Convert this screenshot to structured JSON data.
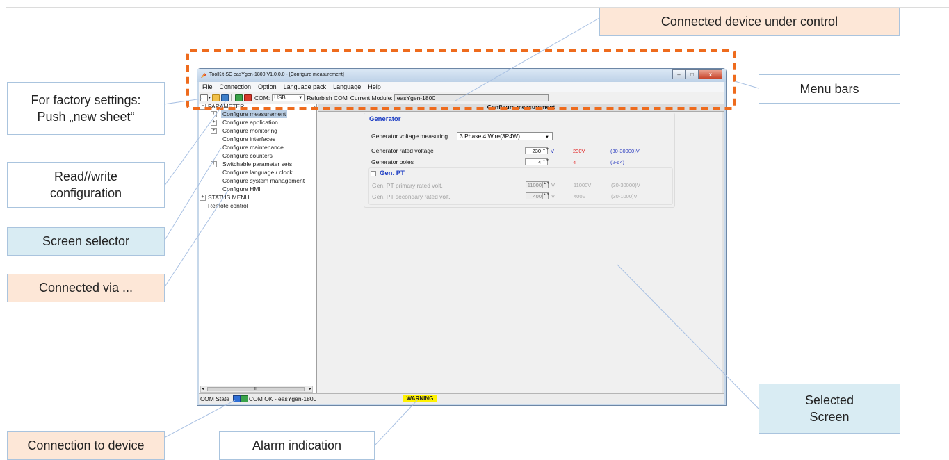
{
  "callouts": {
    "device": "Connected device under control",
    "menu_bars": "Menu bars",
    "factory_line1": "For factory settings:",
    "factory_line2": "Push „new sheet“",
    "rw_line1": "Read//write",
    "rw_line2": "configuration",
    "screen_selector": "Screen selector",
    "connected_via": "Connected via ...",
    "selected_line1": "Selected",
    "selected_line2": "Screen",
    "connection": "Connection to device",
    "alarm": "Alarm indication"
  },
  "colors": {
    "highlight_dash": "#ee6b1d",
    "callout_peach": "#fde7d7",
    "callout_blue": "#d9ecf3",
    "group_title": "#1f3fc4",
    "warning": "#fff200"
  },
  "window": {
    "title": "ToolKit-SC easYgen-1800  V1.0.0.0 - [Configure measurement]",
    "minimize_symbol": "–",
    "maximize_symbol": "□",
    "close_symbol": "x"
  },
  "menu": {
    "items": [
      "File",
      "Connection",
      "Option",
      "Language pack",
      "Language",
      "Help"
    ]
  },
  "toolbar": {
    "com_label": "COM:",
    "com_value": "USB",
    "refurbish": "Refurbish COM",
    "module_label": "Current Module:",
    "module_value": "easYgen-1800"
  },
  "tree": {
    "root": "PARAMETER",
    "items": [
      "Configure measurement",
      "Configure application",
      "Configure monitoring",
      "Configure interfaces",
      "Configure maintenance",
      "Configure counters",
      "Switchable parameter sets",
      "Configure language / clock",
      "Configure system management",
      "Configure HMI"
    ],
    "status_menu": "STATUS MENU",
    "remote": "Remote control",
    "scroll_grip": "III"
  },
  "content": {
    "header": "Configure measurement",
    "collapse": "«",
    "generator_title": "Generator",
    "voltage_measuring_label": "Generator voltage measuring",
    "voltage_measuring_value": "3 Phase,4 Wire(3P4W)",
    "rated_voltage_label": "Generator rated voltage",
    "rated_voltage_value": "230",
    "rated_voltage_unit": "V",
    "rated_voltage_device": "230V",
    "rated_voltage_range": "(30-30000)V",
    "poles_label": "Generator poles",
    "poles_value": "4",
    "poles_device": "4",
    "poles_range": "(2-64)",
    "pt_title": "Gen. PT",
    "pt_primary_label": "Gen. PT primary rated volt.",
    "pt_primary_value": "11000",
    "pt_primary_unit": "V",
    "pt_primary_device": "11000V",
    "pt_primary_range": "(30-30000)V",
    "pt_secondary_label": "Gen. PT secondary rated volt.",
    "pt_secondary_value": "400",
    "pt_secondary_unit": "V",
    "pt_secondary_device": "400V",
    "pt_secondary_range": "(30-1000)V"
  },
  "status": {
    "com_state": "COM State",
    "com_ok": "COM OK - easYgen-1800",
    "warning": "WARNING"
  }
}
